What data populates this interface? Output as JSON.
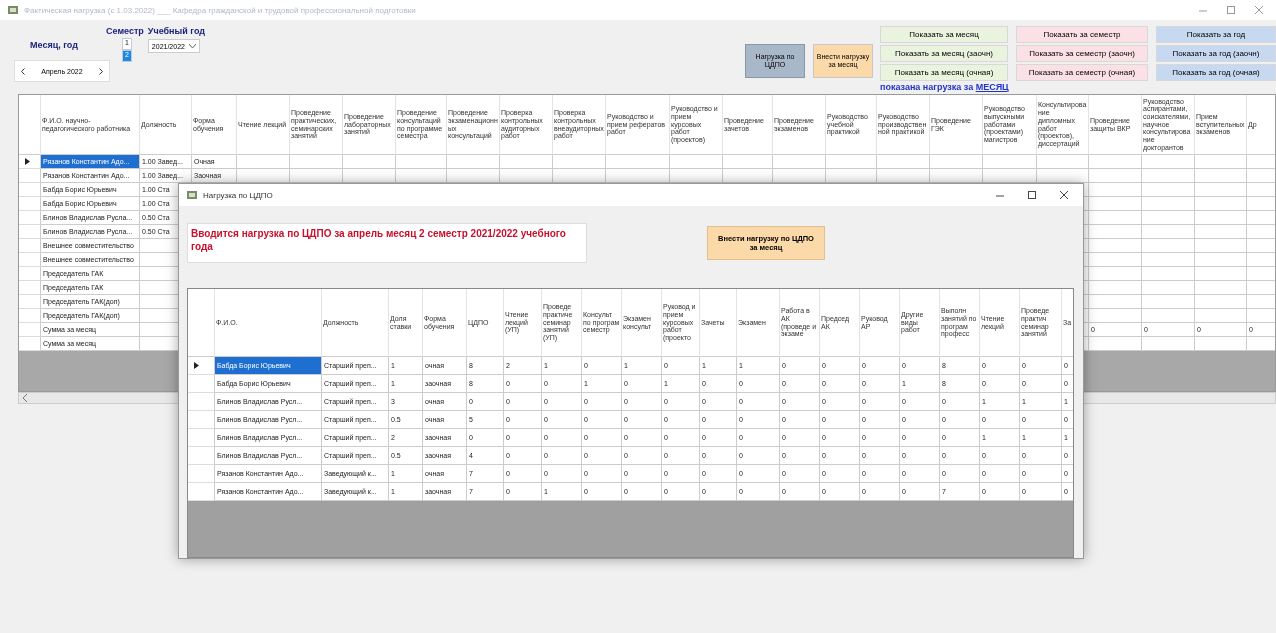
{
  "window": {
    "title": "Фактическая нагрузка (с 1.03.2022) ___ Кафедра гражданской и трудовой профессиональной подготовки"
  },
  "period": {
    "month_label": "Месяц, год",
    "month_value": "Апрель 2022",
    "semester_label": "Семестр",
    "semester_options": [
      {
        "label": "1",
        "selected": false
      },
      {
        "label": "2",
        "selected": true
      }
    ],
    "year_label": "Учебный год",
    "year_value": "2021/2022"
  },
  "actions": [
    {
      "label": "Нагрузка по ЦДПО",
      "color": "#a9b8c8"
    },
    {
      "label": "Внести нагрузку за месяц",
      "color": "#fcd9a8"
    }
  ],
  "show_buttons": [
    {
      "label": "Показать за месяц",
      "color": "#eaf3dd"
    },
    {
      "label": "Показать за семестр",
      "color": "#fbe1e5"
    },
    {
      "label": "Показать за год",
      "color": "#c6d9f0"
    },
    {
      "label": "Показать за месяц (заочн)",
      "color": "#eaf3dd"
    },
    {
      "label": "Показать за семестр (заочн)",
      "color": "#fbe1e5"
    },
    {
      "label": "Показать за год (заочн)",
      "color": "#c6d9f0"
    },
    {
      "label": "Показать за месяц (очная)",
      "color": "#eaf3dd"
    },
    {
      "label": "Показать за семестр (очная)",
      "color": "#fbe1e5"
    },
    {
      "label": "Показать за год (очная)",
      "color": "#c6d9f0"
    }
  ],
  "status": {
    "prefix": "показана нагрузка за",
    "period": "МЕСЯЦ"
  },
  "main_table": {
    "columns": [
      "Ф.И.О. научно-педагогического работника",
      "Должность",
      "Форма обучения",
      "Чтение лекций",
      "Проведение практических, семинарских занятий",
      "Проведение лабораторных занятий",
      "Проведение консультаций по программе семестра",
      "Проведение экзаменационных консультаций",
      "Проверка контрольных аудиторных работ",
      "Проверка контрольных внеаудиторных работ",
      "Руководство и прием рефератов работ",
      "Руководство и прием курсовых работ (проектов)",
      "Проведение зачетов",
      "Проведение экзаменов",
      "Руководство учебной практикой",
      "Руководство производственной практикой",
      "Проведение ГЭК",
      "Руководство выпускными работами (проектами) магистров",
      "Консультирование дипломных работ (проектов), диссертаций",
      "Проведение защиты ВКР",
      "Руководство аспирантами, соискателями, научное консультирование докторантов",
      "Прием вступительных экзаменов",
      "Др"
    ],
    "rows": [
      {
        "selected": true,
        "cells": [
          "Рязанов Константин Адо...",
          "1.00 Завед...",
          "Очная",
          null,
          null,
          null,
          null,
          null,
          null,
          null,
          null,
          null,
          null,
          null,
          null,
          null,
          null,
          null,
          null,
          null,
          null,
          null,
          null
        ]
      },
      {
        "selected": false,
        "cells": [
          "Рязанов Константин Адо...",
          "1.00 Завед...",
          "Заочная",
          null,
          null,
          null,
          null,
          null,
          null,
          null,
          null,
          null,
          null,
          null,
          null,
          null,
          null,
          null,
          null,
          null,
          null,
          null,
          null
        ]
      },
      {
        "selected": false,
        "cells": [
          "Бабда Борис Юрьевич",
          "1.00 Ста",
          null,
          null,
          null,
          null,
          null,
          null,
          null,
          null,
          null,
          null,
          null,
          null,
          null,
          null,
          null,
          null,
          null,
          null,
          null,
          null,
          null
        ]
      },
      {
        "selected": false,
        "cells": [
          "Бабда Борис Юрьевич",
          "1.00 Ста",
          null,
          null,
          null,
          null,
          null,
          null,
          null,
          null,
          null,
          null,
          null,
          null,
          null,
          null,
          null,
          null,
          null,
          null,
          null,
          null,
          null
        ]
      },
      {
        "selected": false,
        "cells": [
          "Блинов Владислав Русла...",
          "0.50 Ста",
          null,
          null,
          null,
          null,
          null,
          null,
          null,
          null,
          null,
          null,
          null,
          null,
          null,
          null,
          null,
          null,
          null,
          null,
          null,
          null,
          null
        ]
      },
      {
        "selected": false,
        "cells": [
          "Блинов Владислав Русла...",
          "0.50 Ста",
          null,
          null,
          null,
          null,
          null,
          null,
          null,
          null,
          null,
          null,
          null,
          null,
          null,
          null,
          null,
          null,
          null,
          null,
          null,
          null,
          null
        ]
      },
      {
        "selected": false,
        "cells": [
          "Внешнее совместительство",
          null,
          null,
          null,
          null,
          null,
          null,
          null,
          null,
          null,
          null,
          null,
          null,
          null,
          null,
          null,
          null,
          null,
          null,
          null,
          null,
          null,
          null
        ]
      },
      {
        "selected": false,
        "cells": [
          "Внешнее совместительство",
          null,
          null,
          null,
          null,
          null,
          null,
          null,
          null,
          null,
          null,
          null,
          null,
          null,
          null,
          null,
          null,
          null,
          null,
          null,
          null,
          null,
          null
        ]
      },
      {
        "selected": false,
        "cells": [
          "Председатель ГАК",
          null,
          null,
          null,
          null,
          null,
          null,
          null,
          null,
          null,
          null,
          null,
          null,
          null,
          null,
          null,
          null,
          null,
          null,
          null,
          null,
          null,
          null
        ]
      },
      {
        "selected": false,
        "cells": [
          "Председатель ГАК",
          null,
          null,
          null,
          null,
          null,
          null,
          null,
          null,
          null,
          null,
          null,
          null,
          null,
          null,
          null,
          null,
          null,
          null,
          null,
          null,
          null,
          null
        ]
      },
      {
        "selected": false,
        "cells": [
          "Председатель ГАК(доп)",
          null,
          null,
          null,
          null,
          null,
          null,
          null,
          null,
          null,
          null,
          null,
          null,
          null,
          null,
          null,
          null,
          null,
          null,
          null,
          null,
          null,
          null
        ]
      },
      {
        "selected": false,
        "cells": [
          "Председатель ГАК(доп)",
          null,
          null,
          null,
          null,
          null,
          null,
          null,
          null,
          null,
          null,
          null,
          null,
          null,
          null,
          null,
          null,
          null,
          null,
          null,
          null,
          null,
          null
        ]
      },
      {
        "selected": false,
        "cells": [
          "Сумма за месяц",
          null,
          null,
          null,
          null,
          null,
          null,
          null,
          null,
          null,
          null,
          null,
          null,
          null,
          null,
          null,
          null,
          null,
          null,
          "0",
          "0",
          "0",
          "0"
        ]
      },
      {
        "selected": false,
        "cells": [
          "Сумма за месяц",
          null,
          null,
          null,
          null,
          null,
          null,
          null,
          null,
          null,
          null,
          null,
          null,
          null,
          null,
          null,
          null,
          null,
          null,
          null,
          null,
          null,
          null
        ]
      }
    ]
  },
  "dialog": {
    "title": "Нагрузка по ЦДПО",
    "message": "Вводится нагрузка по ЦДПО за апрель месяц 2 семестр 2021/2022 учебного года",
    "button": "Внести нагрузку по ЦДПО за месяц",
    "columns": [
      "Ф.И.О.",
      "Должность",
      "Доля ставки",
      "Форма обучения",
      "ЦДПО",
      "Чтение лекций (УП)",
      "Проведе практиче семинар занятий (УП)",
      "Консульт по програм семестр",
      "Экзамен консульт",
      "Руковод и прием курсовых работ (проекто",
      "Зачеты",
      "Экзамен",
      "Работа в АК (проведе и экзаме",
      "Председ АК",
      "Руковод АР",
      "Другие виды работ",
      "Выполн занятий по програм професс",
      "Чтение лекций",
      "Проведе практич семинар занятий",
      "За"
    ],
    "rows": [
      {
        "selected": true,
        "cells": [
          "Бабда Борис Юрьевич",
          "Старший преп...",
          "1",
          "очная",
          "8",
          "2",
          "1",
          "0",
          "1",
          "0",
          "1",
          "1",
          "0",
          "0",
          "0",
          "0",
          "8",
          "0",
          "0",
          "0"
        ]
      },
      {
        "selected": false,
        "cells": [
          "Бабда Борис Юрьевич",
          "Старший преп...",
          "1",
          "заочная",
          "8",
          "0",
          "0",
          "1",
          "0",
          "1",
          "0",
          "0",
          "0",
          "0",
          "0",
          "1",
          "8",
          "0",
          "0",
          "0"
        ]
      },
      {
        "selected": false,
        "cells": [
          "Блинов Владислав Русл...",
          "Старший преп...",
          "3",
          "очная",
          "0",
          "0",
          "0",
          "0",
          "0",
          "0",
          "0",
          "0",
          "0",
          "0",
          "0",
          "0",
          "0",
          "1",
          "1",
          "1"
        ]
      },
      {
        "selected": false,
        "cells": [
          "Блинов Владислав Русл...",
          "Старший преп...",
          "0.5",
          "очная",
          "5",
          "0",
          "0",
          "0",
          "0",
          "0",
          "0",
          "0",
          "0",
          "0",
          "0",
          "0",
          "0",
          "0",
          "0",
          "0"
        ]
      },
      {
        "selected": false,
        "cells": [
          "Блинов Владислав Русл...",
          "Старший преп...",
          "2",
          "заочная",
          "0",
          "0",
          "0",
          "0",
          "0",
          "0",
          "0",
          "0",
          "0",
          "0",
          "0",
          "0",
          "0",
          "1",
          "1",
          "1"
        ]
      },
      {
        "selected": false,
        "cells": [
          "Блинов Владислав Русл...",
          "Старший преп...",
          "0.5",
          "заочная",
          "4",
          "0",
          "0",
          "0",
          "0",
          "0",
          "0",
          "0",
          "0",
          "0",
          "0",
          "0",
          "0",
          "0",
          "0",
          "0"
        ]
      },
      {
        "selected": false,
        "cells": [
          "Рязанов Константин Адо...",
          "Заведующий к...",
          "1",
          "очная",
          "7",
          "0",
          "0",
          "0",
          "0",
          "0",
          "0",
          "0",
          "0",
          "0",
          "0",
          "0",
          "0",
          "0",
          "0",
          "0"
        ]
      },
      {
        "selected": false,
        "cells": [
          "Рязанов Константин Адо...",
          "Заведующий к...",
          "1",
          "заочная",
          "7",
          "0",
          "1",
          "0",
          "0",
          "0",
          "0",
          "0",
          "0",
          "0",
          "0",
          "0",
          "7",
          "0",
          "0",
          "0"
        ]
      }
    ]
  }
}
